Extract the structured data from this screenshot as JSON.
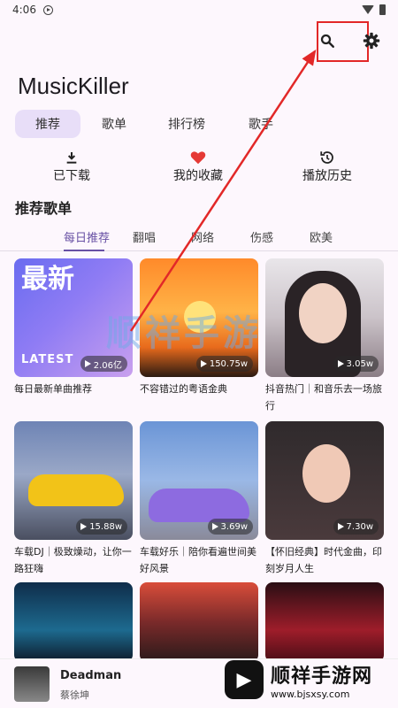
{
  "status_bar": {
    "time": "4:06"
  },
  "app": {
    "title": "MusicKiller"
  },
  "top_tabs": [
    {
      "label": "推荐",
      "active": true
    },
    {
      "label": "歌单",
      "active": false
    },
    {
      "label": "排行榜",
      "active": false
    },
    {
      "label": "歌手",
      "active": false
    }
  ],
  "quick_actions": [
    {
      "label": "已下载",
      "icon": "download-icon"
    },
    {
      "label": "我的收藏",
      "icon": "heart-icon"
    },
    {
      "label": "播放历史",
      "icon": "history-icon"
    }
  ],
  "section": {
    "title": "推荐歌单"
  },
  "category_tabs": [
    {
      "label": "每日推荐",
      "active": true
    },
    {
      "label": "翻唱",
      "active": false
    },
    {
      "label": "网络",
      "active": false
    },
    {
      "label": "伤感",
      "active": false
    },
    {
      "label": "欧美",
      "active": false
    }
  ],
  "playlists": [
    {
      "title": "每日最新单曲推荐",
      "plays": "2.06亿",
      "cover_text": "最新",
      "cover_subtext": "LATEST"
    },
    {
      "title": "不容错过的粤语金典",
      "plays": "150.75w"
    },
    {
      "title": "抖音热门｜和音乐去一场旅行",
      "plays": "3.05w"
    },
    {
      "title": "车载DJ｜极致燥动，让你一路狂嗨",
      "plays": "15.88w"
    },
    {
      "title": "车载好乐｜陪你看遍世间美好风景",
      "plays": "3.69w"
    },
    {
      "title": "【怀旧经典】时代金曲，印刻岁月人生",
      "plays": "7.30w"
    },
    {
      "title": "",
      "plays": ""
    },
    {
      "title": "",
      "plays": ""
    },
    {
      "title": "",
      "plays": ""
    }
  ],
  "now_playing": {
    "song": "Deadman",
    "artist": "蔡徐坤"
  },
  "watermark": {
    "title": "顺祥手游网",
    "url": "www.bjsxsy.com",
    "mid_text": "顺祥手游"
  },
  "colors": {
    "accent": "#6750a4",
    "active_tab_bg": "#e8def8",
    "highlight": "#e22828",
    "heart": "#e53935"
  }
}
